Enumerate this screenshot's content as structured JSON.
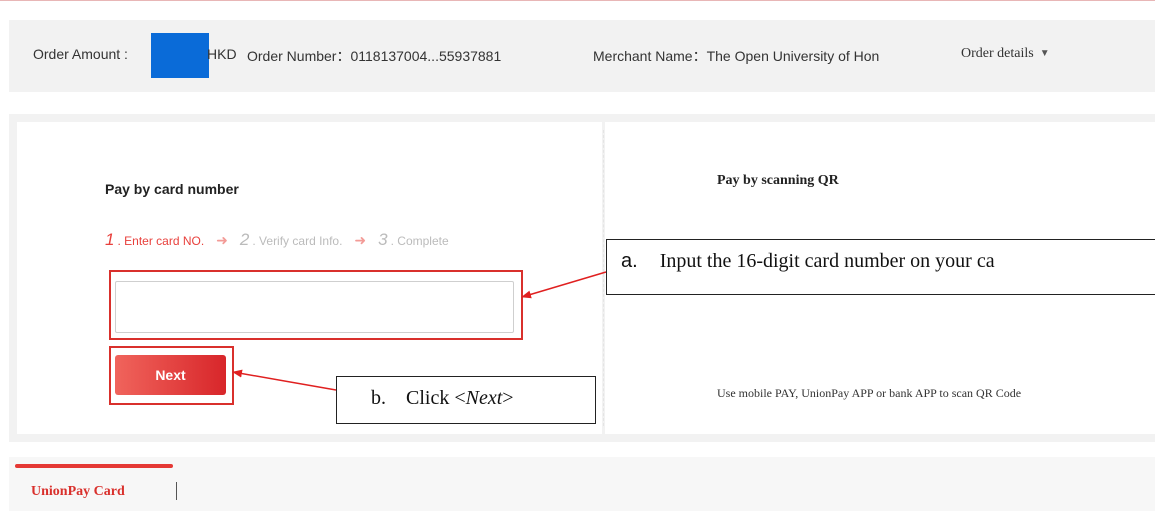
{
  "order_bar": {
    "amount_label": "Order Amount :",
    "amount_currency": "HKD",
    "order_number": "Order Number：0118137004...55937881",
    "merchant_name": "Merchant Name：The Open University of Hon",
    "order_details_label": "Order details"
  },
  "card_panel": {
    "title": "Pay by card number",
    "steps": [
      {
        "num": "1",
        "label": "Enter card NO."
      },
      {
        "num": "2",
        "label": "Verify card Info."
      },
      {
        "num": "3",
        "label": "Complete"
      }
    ],
    "card_input_value": "",
    "next_label": "Next"
  },
  "qr_panel": {
    "title": "Pay by scanning QR",
    "hint": "Use mobile PAY, UnionPay APP or bank APP to scan QR Code"
  },
  "annotations": {
    "a_letter": "a.",
    "a_text": "Input the 16-digit card number on your ca",
    "b_letter": "b.",
    "b_text_prefix": "Click <",
    "b_text_em": "Next",
    "b_text_suffix": ">"
  },
  "tabs": {
    "active_label": "UnionPay Card"
  },
  "colors": {
    "accent_red": "#d9302c",
    "amount_mask": "#0a6bd8",
    "link_blue": "#2f6fd0"
  },
  "icons": {
    "order_details": "chevron-down-icon",
    "step_separator": "arrow-right-icon"
  }
}
